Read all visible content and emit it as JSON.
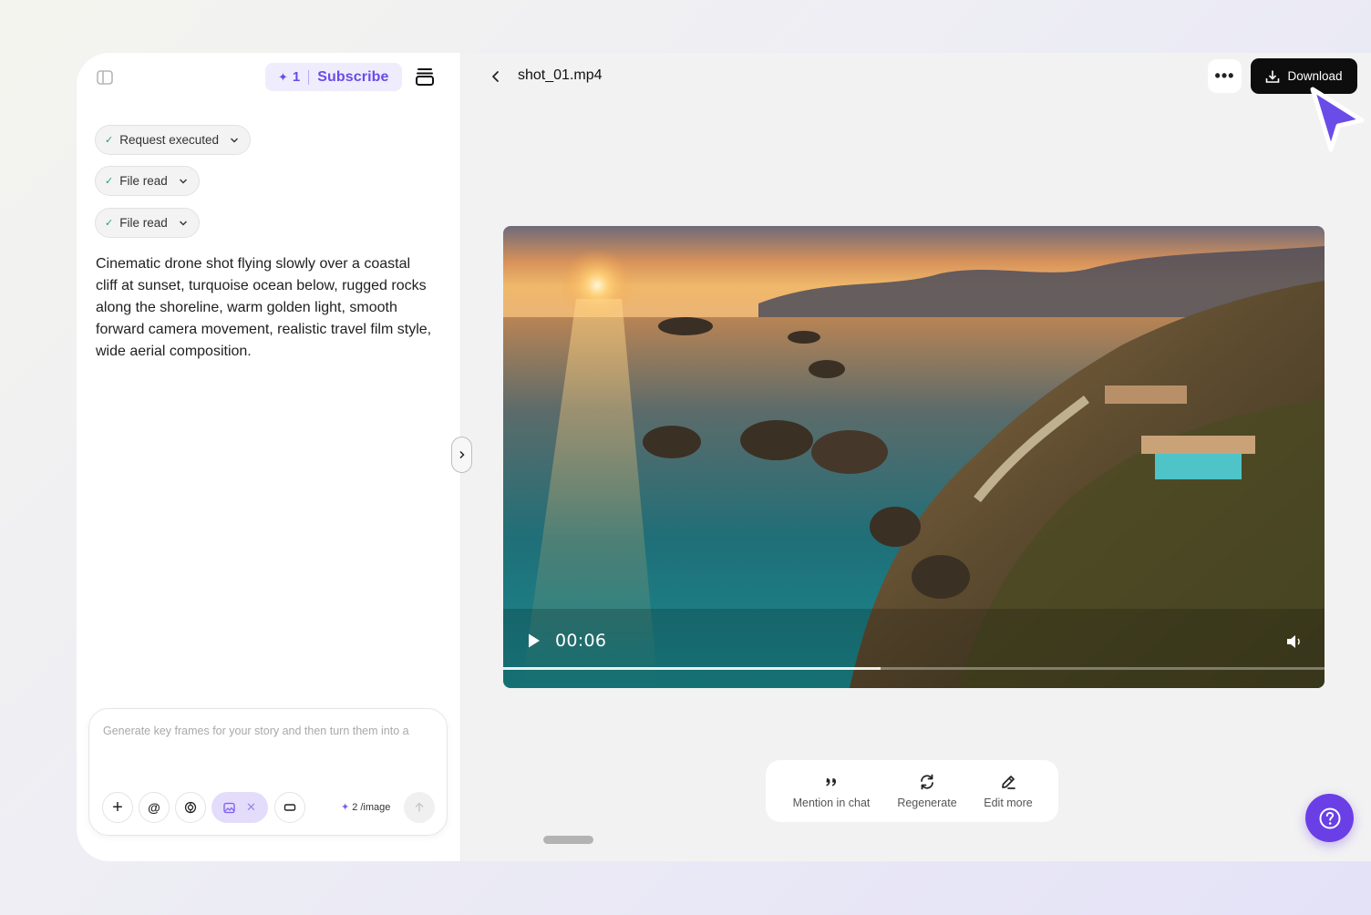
{
  "header": {
    "credits": "1",
    "subscribe_label": "Subscribe",
    "file_name": "shot_01.mp4",
    "more_label": "•••",
    "download_label": "Download"
  },
  "steps": [
    {
      "label": "Request executed",
      "status": "done"
    },
    {
      "label": "File read",
      "status": "done"
    },
    {
      "label": "File read",
      "status": "done"
    }
  ],
  "prompt": "Cinematic drone shot flying slowly over a coastal cliff at sunset, turquoise ocean below, rugged rocks along the shoreline, warm golden light, smooth forward camera movement, realistic travel film style, wide aerial composition.",
  "composer": {
    "placeholder": "Generate key frames for your story and then turn them into a",
    "cost": "2",
    "cost_unit": "/image"
  },
  "video": {
    "timecode": "00:06",
    "progress": 0.46
  },
  "actions": [
    {
      "label": "Mention in chat",
      "icon": "quote-icon"
    },
    {
      "label": "Regenerate",
      "icon": "refresh-icon"
    },
    {
      "label": "Edit more",
      "icon": "pencil-icon"
    }
  ],
  "colors": {
    "accent": "#6a3fe6",
    "download_bg": "#0d0d0d",
    "check": "#22a36b"
  }
}
